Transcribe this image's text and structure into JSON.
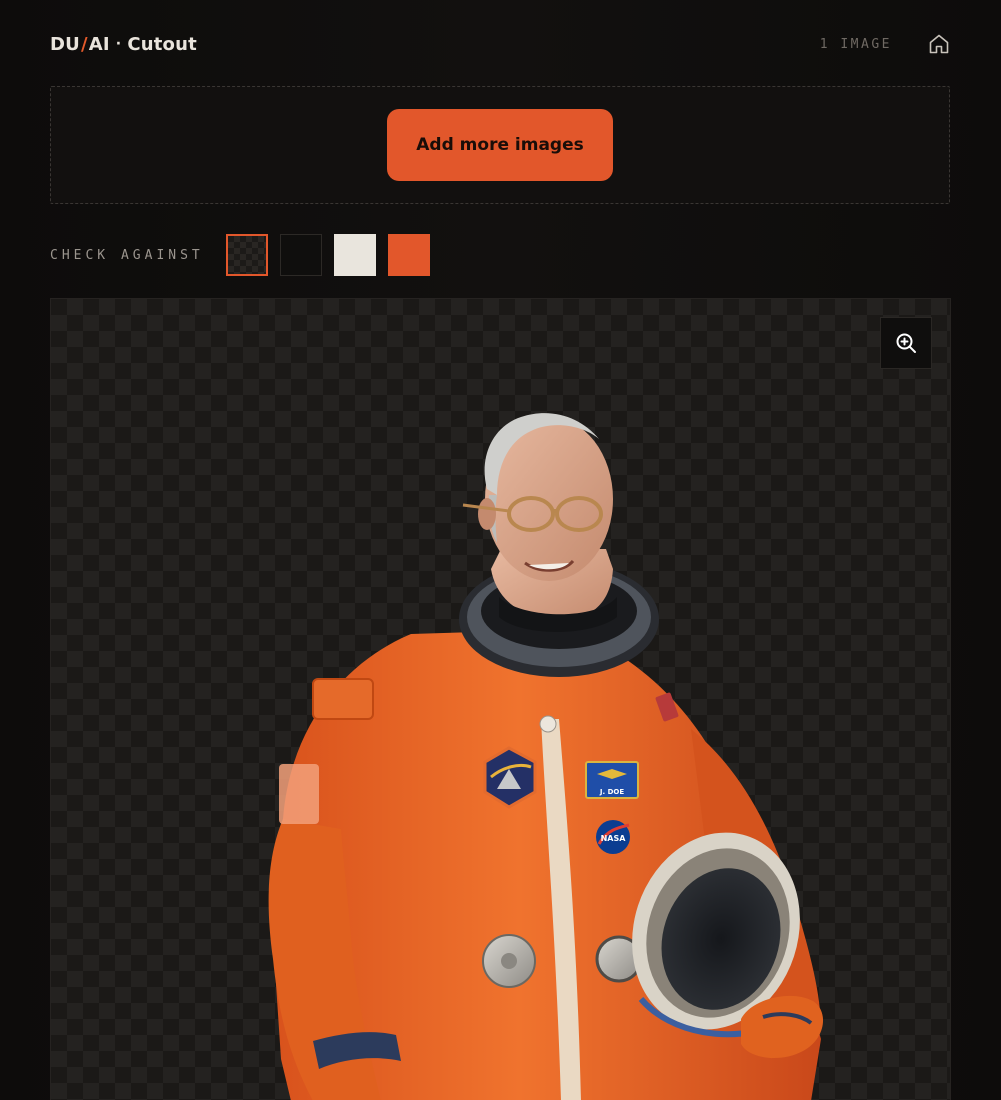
{
  "header": {
    "brand_left": "DU",
    "brand_slash": "/",
    "brand_mid": "AI",
    "brand_sep": "·",
    "brand_product": "Cutout",
    "image_count": "1 IMAGE",
    "home_icon": "home-icon"
  },
  "dropzone": {
    "add_button_label": "Add more images"
  },
  "check_against": {
    "label": "CHECK AGAINST",
    "swatches": [
      {
        "name": "checker",
        "color": "#1c1a18",
        "selected": true
      },
      {
        "name": "black",
        "color": "#0f0e0d",
        "selected": false
      },
      {
        "name": "cream",
        "color": "#e9e5dd",
        "selected": false
      },
      {
        "name": "orange",
        "color": "#e2572b",
        "selected": false
      }
    ]
  },
  "preview": {
    "zoom_icon": "zoom-in-icon",
    "name_tag": "J. DOE",
    "patch_text": "NASA"
  },
  "colors": {
    "accent": "#e2572b",
    "background": "#100e0d",
    "text": "#e9e4dc",
    "muted": "#6f6963"
  }
}
